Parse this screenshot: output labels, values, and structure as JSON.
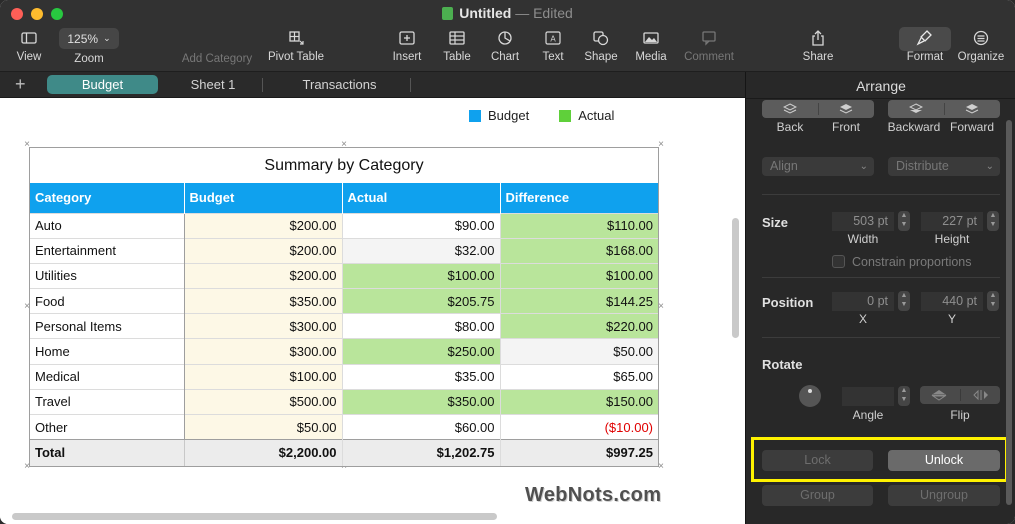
{
  "window": {
    "title": "Untitled",
    "separator": "—",
    "edited": "Edited"
  },
  "toolbar": {
    "view": {
      "label": "View",
      "icon": "sidebar-icon"
    },
    "zoom": {
      "value": "125%",
      "label": "Zoom"
    },
    "add_category": {
      "label": "Add Category"
    },
    "pivot_table": {
      "label": "Pivot Table",
      "icon": "pivot-table-icon"
    },
    "insert": {
      "label": "Insert",
      "icon": "insert-icon"
    },
    "table": {
      "label": "Table",
      "icon": "table-icon"
    },
    "chart": {
      "label": "Chart",
      "icon": "chart-icon"
    },
    "text": {
      "label": "Text",
      "icon": "text-icon"
    },
    "shape": {
      "label": "Shape",
      "icon": "shape-icon"
    },
    "media": {
      "label": "Media",
      "icon": "media-icon"
    },
    "comment": {
      "label": "Comment",
      "icon": "comment-icon"
    },
    "share": {
      "label": "Share",
      "icon": "share-icon"
    },
    "format": {
      "label": "Format",
      "icon": "paintbrush-icon"
    },
    "organize": {
      "label": "Organize",
      "icon": "organize-icon"
    }
  },
  "tabs": [
    {
      "label": "Budget",
      "active": true
    },
    {
      "label": "Sheet 1",
      "active": false
    },
    {
      "label": "Transactions",
      "active": false
    }
  ],
  "legend": [
    {
      "label": "Budget",
      "color": "#0fa1ee"
    },
    {
      "label": "Actual",
      "color": "#5fd03a"
    }
  ],
  "table": {
    "title": "Summary by Category",
    "columns": [
      "Category",
      "Budget",
      "Actual",
      "Difference"
    ],
    "rows": [
      [
        "Auto",
        "$200.00",
        "$90.00",
        "$110.00"
      ],
      [
        "Entertainment",
        "$200.00",
        "$32.00",
        "$168.00"
      ],
      [
        "Utilities",
        "$200.00",
        "$100.00",
        "$100.00"
      ],
      [
        "Food",
        "$350.00",
        "$205.75",
        "$144.25"
      ],
      [
        "Personal Items",
        "$300.00",
        "$80.00",
        "$220.00"
      ],
      [
        "Home",
        "$300.00",
        "$250.00",
        "$50.00"
      ],
      [
        "Medical",
        "$100.00",
        "$35.00",
        "$65.00"
      ],
      [
        "Travel",
        "$500.00",
        "$350.00",
        "$150.00"
      ],
      [
        "Other",
        "$50.00",
        "$60.00",
        "($10.00)"
      ]
    ],
    "total": [
      "Total",
      "$2,200.00",
      "$1,202.75",
      "$997.25"
    ]
  },
  "watermark": "WebNots.com",
  "inspector": {
    "title": "Arrange",
    "back": "Back",
    "front": "Front",
    "backward": "Backward",
    "forward": "Forward",
    "align": "Align",
    "distribute": "Distribute",
    "size_label": "Size",
    "width_value": "503 pt",
    "width_label": "Width",
    "height_value": "227 pt",
    "height_label": "Height",
    "constrain": "Constrain proportions",
    "position_label": "Position",
    "x_value": "0 pt",
    "x_label": "X",
    "y_value": "440 pt",
    "y_label": "Y",
    "rotate_label": "Rotate",
    "angle_label": "Angle",
    "flip_label": "Flip",
    "lock": "Lock",
    "unlock": "Unlock",
    "group": "Group",
    "ungroup": "Ungroup"
  },
  "colors": {
    "header_blue": "#0fa1ee",
    "highlight_green": "#b9e59b",
    "budget_fill": "#fdf8e6",
    "active_tab": "#3f8a88",
    "highlight_box": "#fff200",
    "negative": "#e00000"
  }
}
